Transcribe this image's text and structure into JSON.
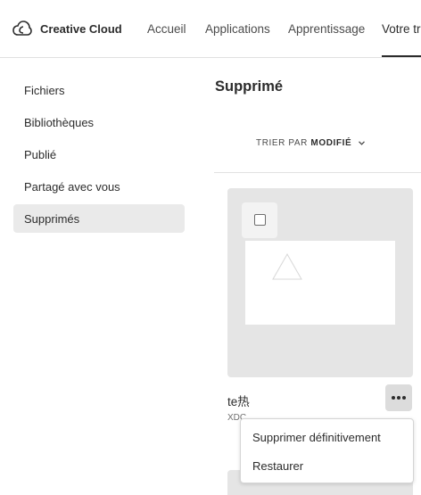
{
  "header": {
    "brand": "Creative Cloud",
    "logo_icon": "creative-cloud-logo-icon",
    "tabs": [
      {
        "label": "Accueil"
      },
      {
        "label": "Applications"
      },
      {
        "label": "Apprentissage"
      },
      {
        "label": "Votre tra"
      }
    ],
    "active_tab": 3
  },
  "sidebar": {
    "items": [
      {
        "label": "Fichiers"
      },
      {
        "label": "Bibliothèques"
      },
      {
        "label": "Publié"
      },
      {
        "label": "Partagé avec vous"
      },
      {
        "label": "Supprimés"
      }
    ],
    "active_item": 4
  },
  "main": {
    "title": "Supprimé",
    "sort": {
      "prefix": "TRIER PAR",
      "value": "MODIFIÉ",
      "chevron": "chevron-down-icon"
    },
    "file": {
      "name": "te热",
      "type": "XDC",
      "thumbnail_icon": "triangle-placeholder-icon",
      "more_icon": "more-dots-icon"
    },
    "context_menu": {
      "items": [
        {
          "label": "Supprimer définitivement"
        },
        {
          "label": "Restaurer"
        }
      ]
    }
  }
}
